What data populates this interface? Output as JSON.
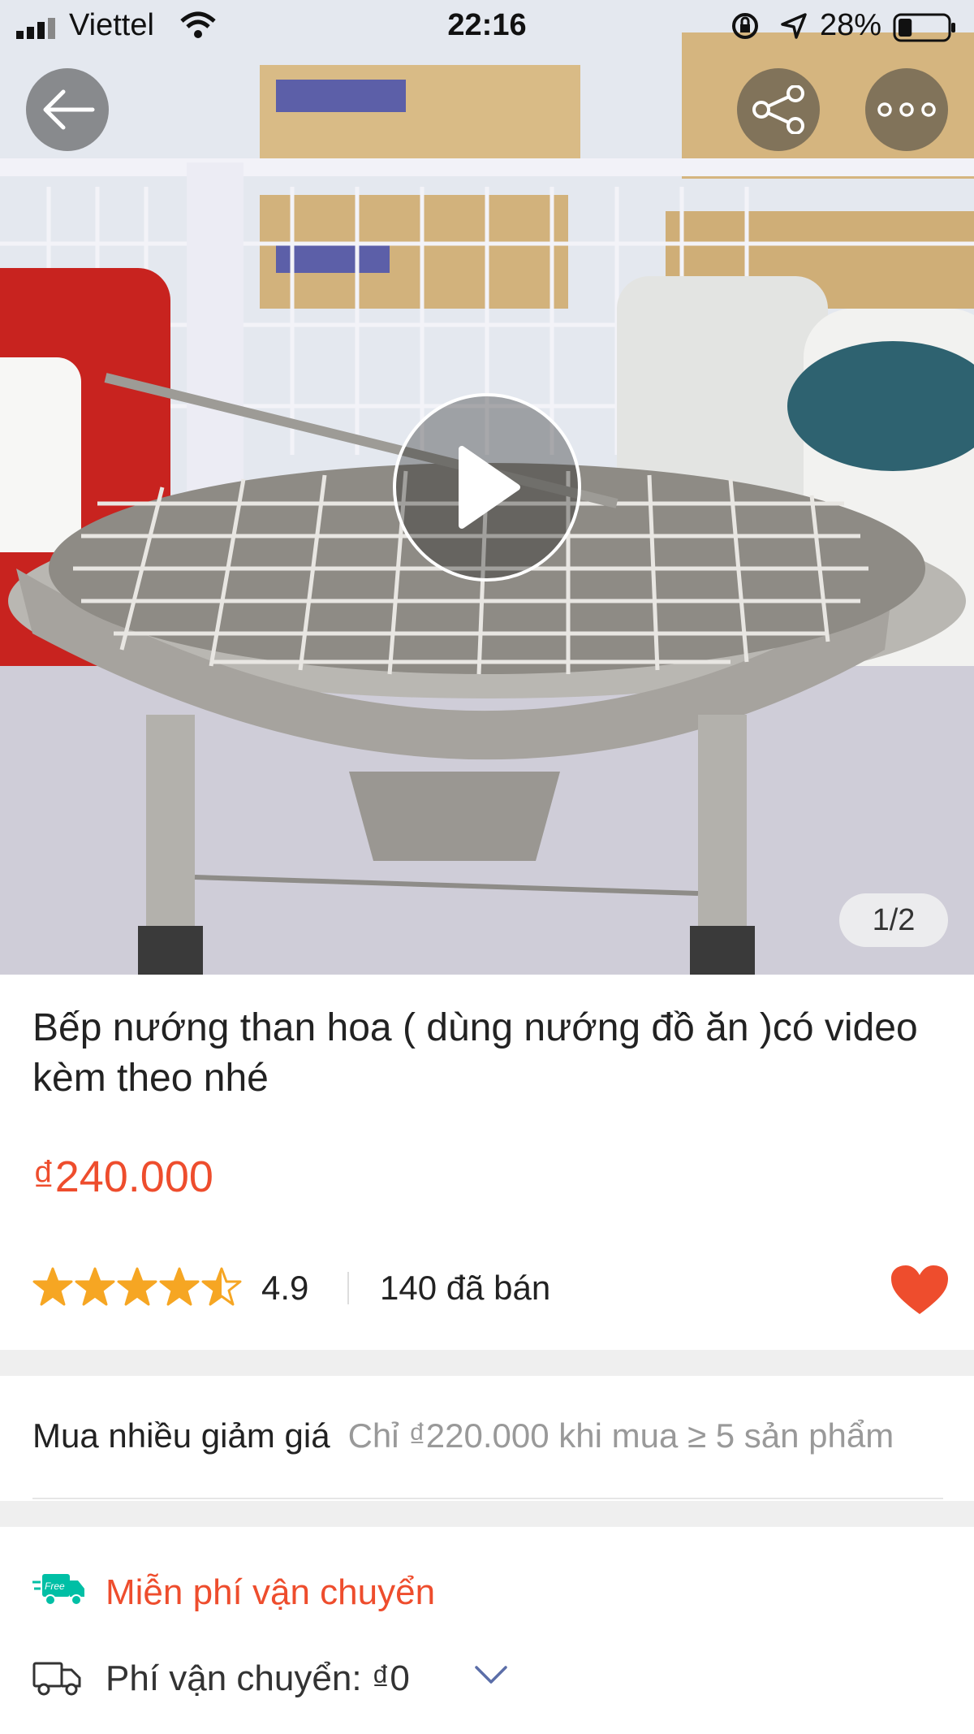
{
  "status_bar": {
    "carrier": "Viettel",
    "time": "22:16",
    "battery": "28%",
    "battery_level": 0.28
  },
  "gallery": {
    "page_indicator": "1/2",
    "back_icon": "arrow-left-icon",
    "share_icon": "share-icon",
    "more_icon": "more-dots-icon",
    "play_icon": "play-icon"
  },
  "product": {
    "title": "Bếp nướng than hoa ( dùng nướng đồ ăn )có video kèm theo nhé",
    "price": "₫240.000",
    "rating": 4.5,
    "rating_text": "4.9",
    "sold": "140 đã bán",
    "favorite_icon": "heart-icon",
    "favorite_color": "#ee4d2d"
  },
  "bulk_discount": {
    "label": "Mua nhiều giảm giá",
    "description": "Chỉ ₫220.000 khi mua ≥ 5 sản phẩm"
  },
  "shipping": {
    "free_label": "Miễn phí vận chuyển",
    "free_badge": "Free",
    "fee_label": "Phí vận chuyển: ₫0"
  },
  "colors": {
    "accent": "#ee4d2d",
    "star": "#f6a623"
  }
}
